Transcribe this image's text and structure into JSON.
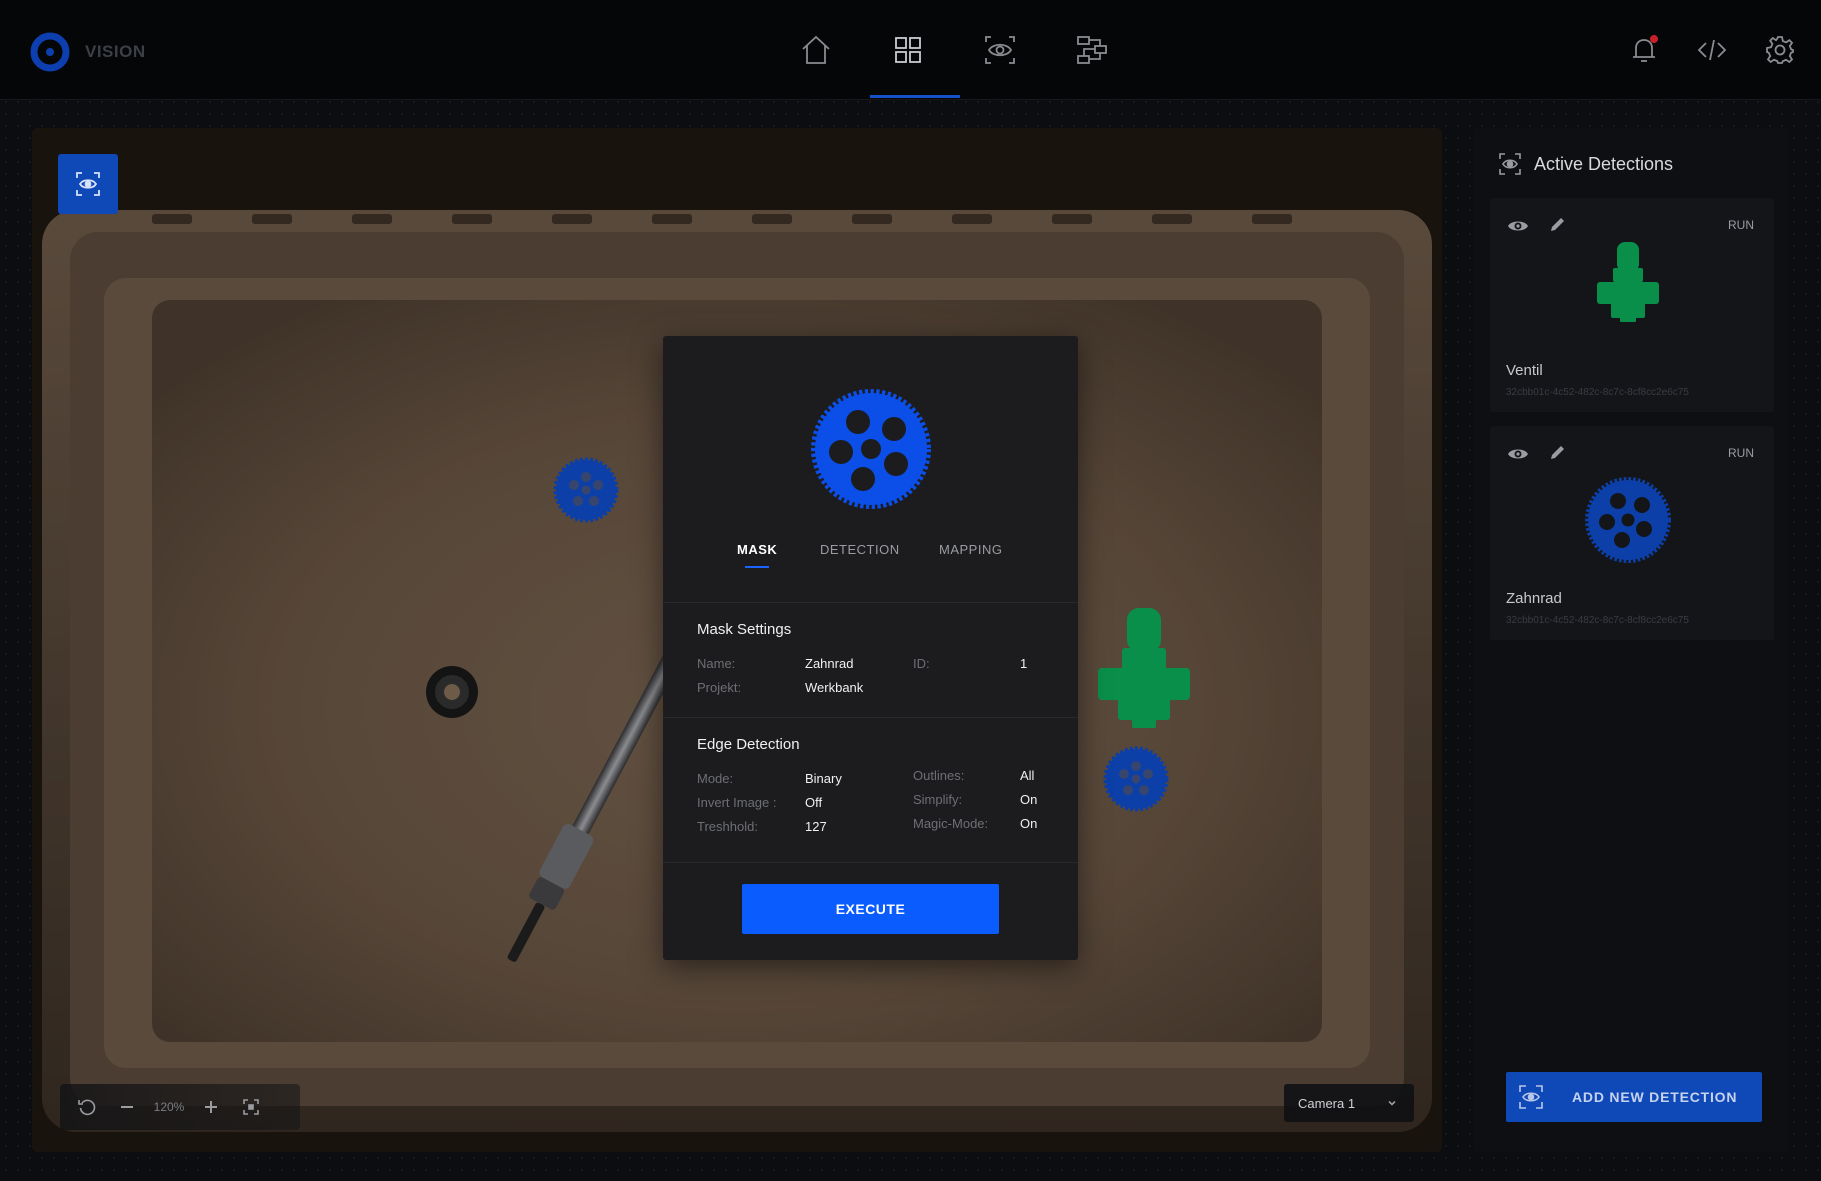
{
  "app": {
    "name": "VISION"
  },
  "nav": {
    "items": [
      {
        "icon": "home-icon",
        "active": false
      },
      {
        "icon": "grid-icon",
        "active": true
      },
      {
        "icon": "eye-scan-icon",
        "active": false
      },
      {
        "icon": "workflow-icon",
        "active": false
      }
    ]
  },
  "header_actions": {
    "notification_icon": "bell-icon",
    "code_icon": "code-icon",
    "settings_icon": "gear-icon"
  },
  "canvas": {
    "zoom_level": "120%",
    "camera": "Camera 1"
  },
  "modal": {
    "tabs": [
      "MASK",
      "DETECTION",
      "MAPPING"
    ],
    "active_tab": "MASK",
    "mask_settings": {
      "title": "Mask Settings",
      "name_label": "Name:",
      "name_value": "Zahnrad",
      "project_label": "Projekt:",
      "project_value": "Werkbank",
      "id_label": "ID:",
      "id_value": "1"
    },
    "edge_detection": {
      "title": "Edge Detection",
      "mode_label": "Mode:",
      "mode_value": "Binary",
      "invert_label": "Invert Image :",
      "invert_value": "Off",
      "threshold_label": "Treshhold:",
      "threshold_value": "127",
      "outlines_label": "Outlines:",
      "outlines_value": "All",
      "simplify_label": "Simplify:",
      "simplify_value": "On",
      "magic_label": "Magic-Mode:",
      "magic_value": "On"
    },
    "execute_label": "EXECUTE"
  },
  "panel": {
    "title": "Active Detections",
    "detections": [
      {
        "name": "Ventil",
        "uuid": "32cbb01c-4c52-482c-8c7c-8cf8cc2e6c75",
        "run_label": "RUN",
        "color": "#0a8f4a"
      },
      {
        "name": "Zahnrad",
        "uuid": "32cbb01c-4c52-482c-8c7c-8cf8cc2e6c75",
        "run_label": "RUN",
        "color": "#0c3fa8"
      }
    ],
    "add_label": "ADD NEW DETECTION"
  },
  "colors": {
    "accent": "#0b5cff",
    "accent_dark": "#0f48b7",
    "gear_blue": "#0b4fe8",
    "valve_green": "#0a8f4a"
  }
}
